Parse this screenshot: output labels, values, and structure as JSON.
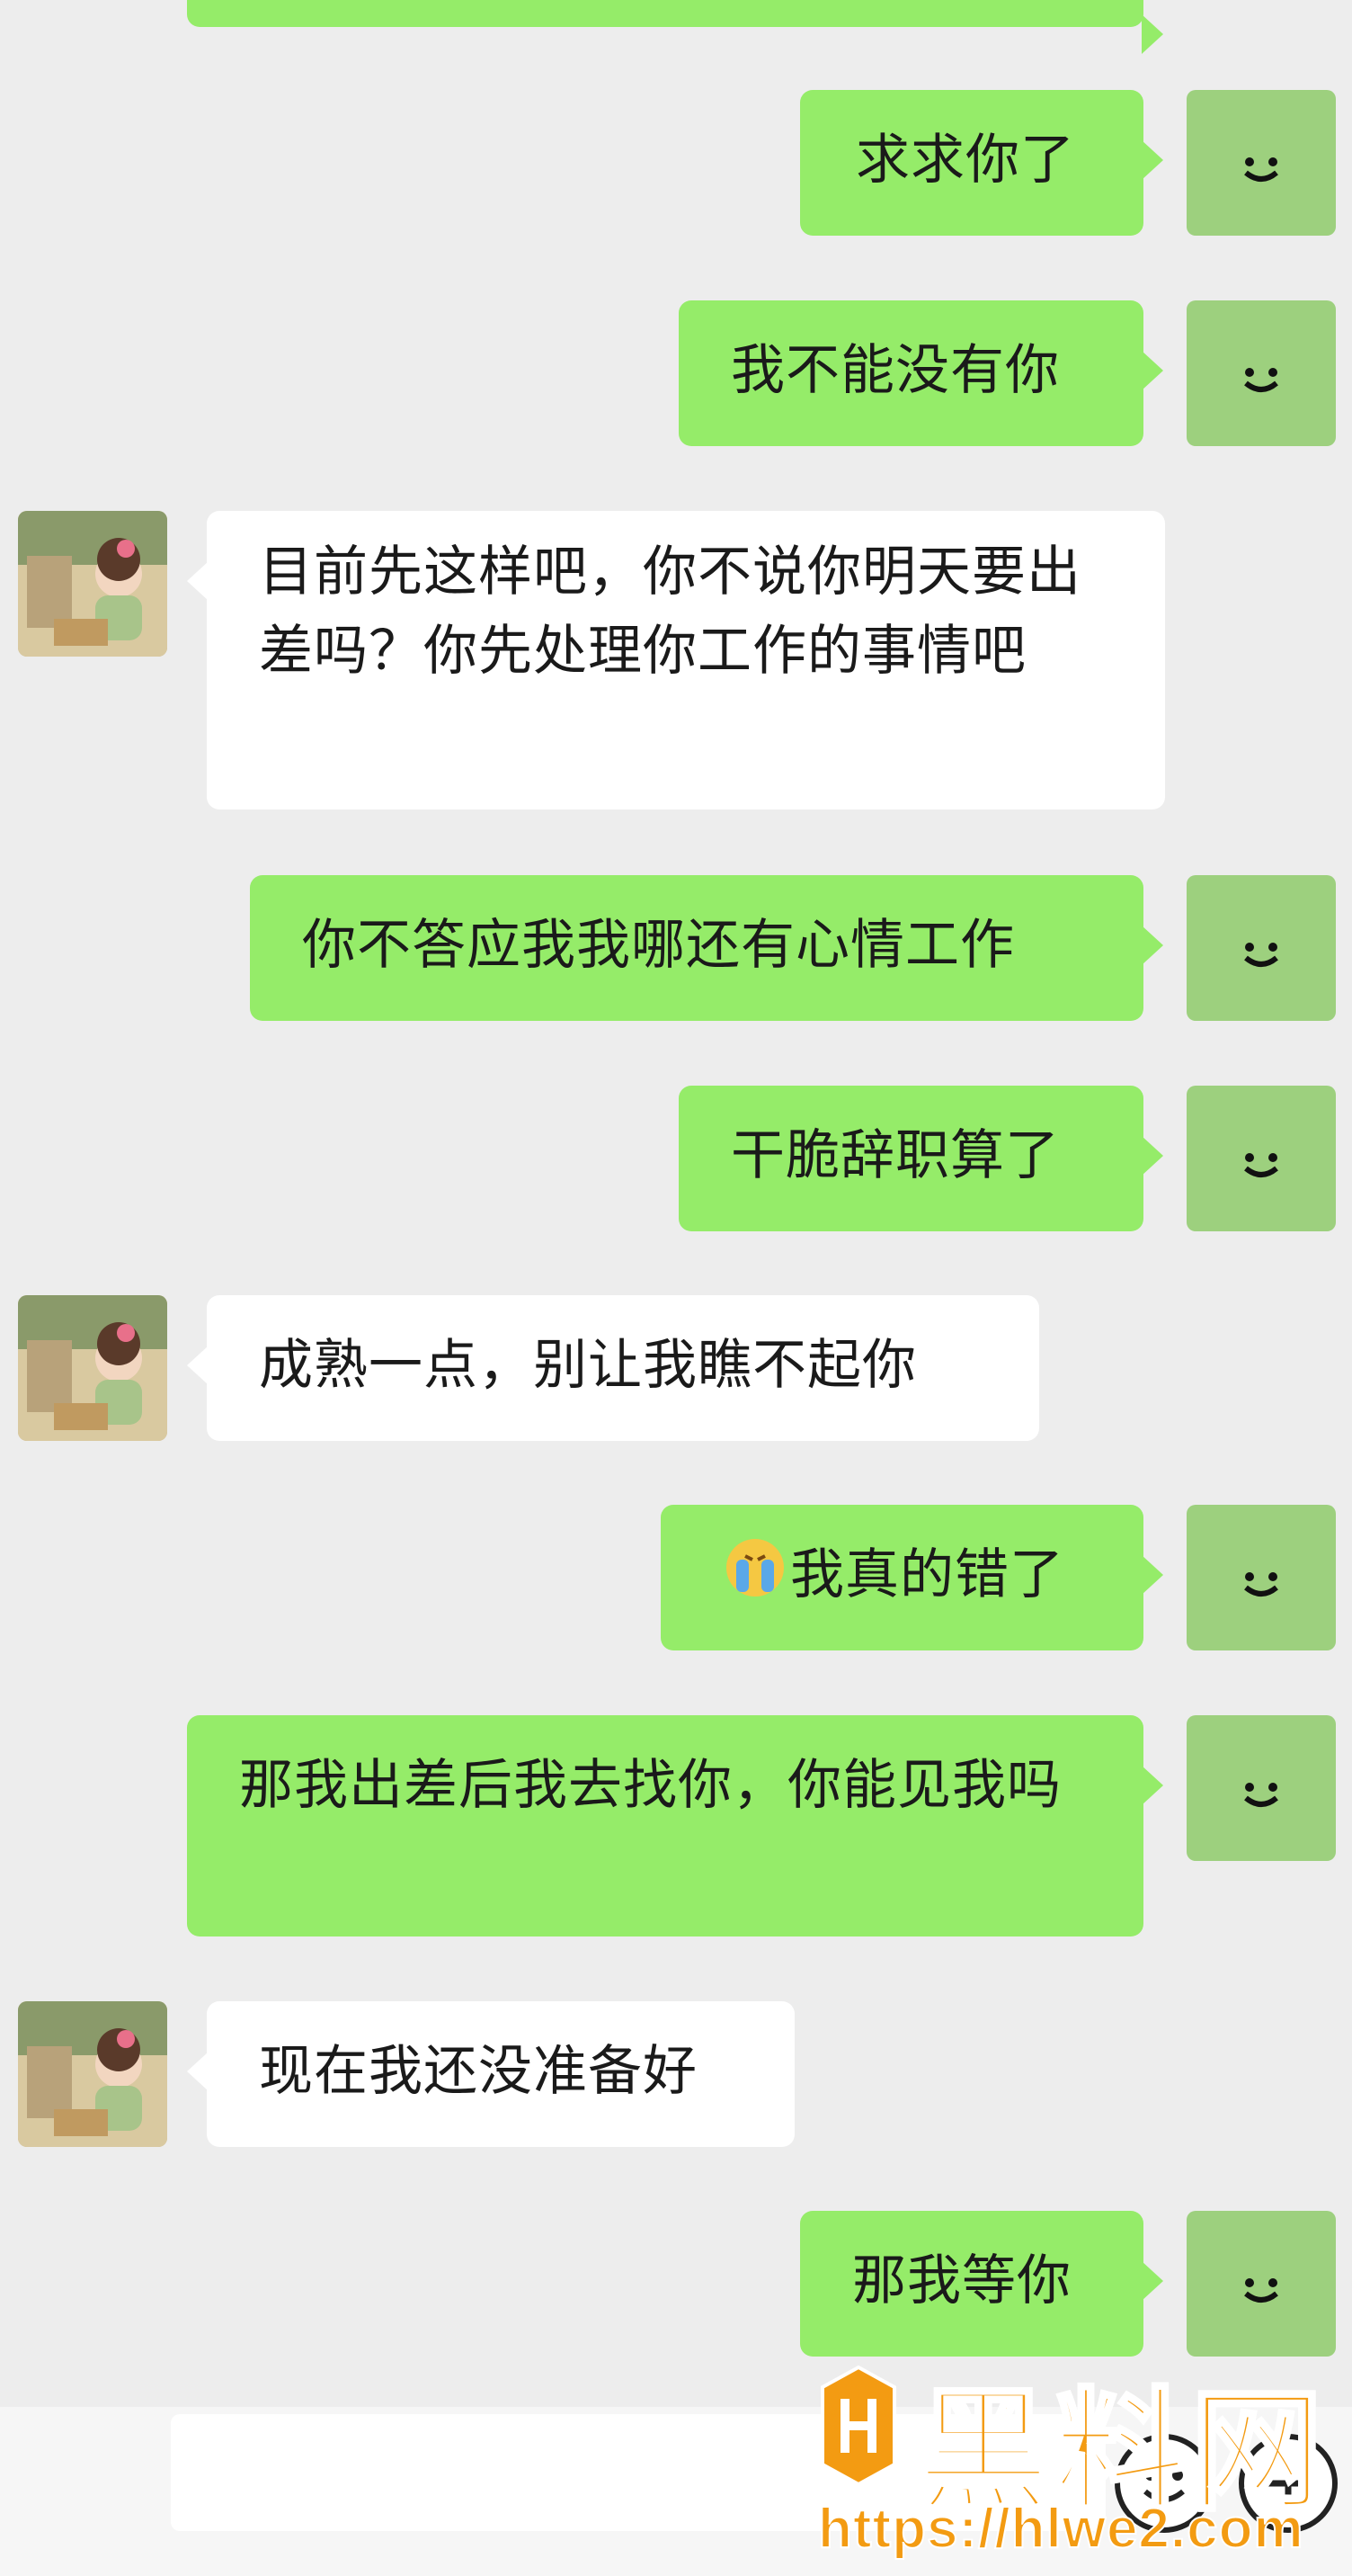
{
  "chat": {
    "messages": [
      {
        "side": "right",
        "text": ""
      },
      {
        "side": "right",
        "text": "求求你了"
      },
      {
        "side": "right",
        "text": "我不能没有你"
      },
      {
        "side": "left",
        "text": "目前先这样吧，你不说你明天要出差吗？你先处理你工作的事情吧"
      },
      {
        "side": "right",
        "text": "你不答应我我哪还有心情工作"
      },
      {
        "side": "right",
        "text": "干脆辞职算了"
      },
      {
        "side": "left",
        "text": "成熟一点，别让我瞧不起你"
      },
      {
        "side": "right",
        "text": "我真的错了"
      },
      {
        "side": "right",
        "text": "那我出差后我去找你，你能见我吗"
      },
      {
        "side": "left",
        "text": "现在我还没准备好"
      },
      {
        "side": "right",
        "text": "那我等你"
      }
    ],
    "colors": {
      "self_bubble": "#95ec69",
      "other_bubble": "#ffffff",
      "background": "#ededed"
    },
    "icons": {
      "self_avatar": "smiley-avatar",
      "other_avatar": "cartoon-girl-avatar",
      "inline_emoji": "crying-emoji"
    }
  },
  "input_bar": {
    "emoji_icon": "emoji-icon",
    "plus_icon": "plus-icon"
  },
  "watermark": {
    "brand": "黑料网",
    "url": "https://hlwe2.com"
  }
}
